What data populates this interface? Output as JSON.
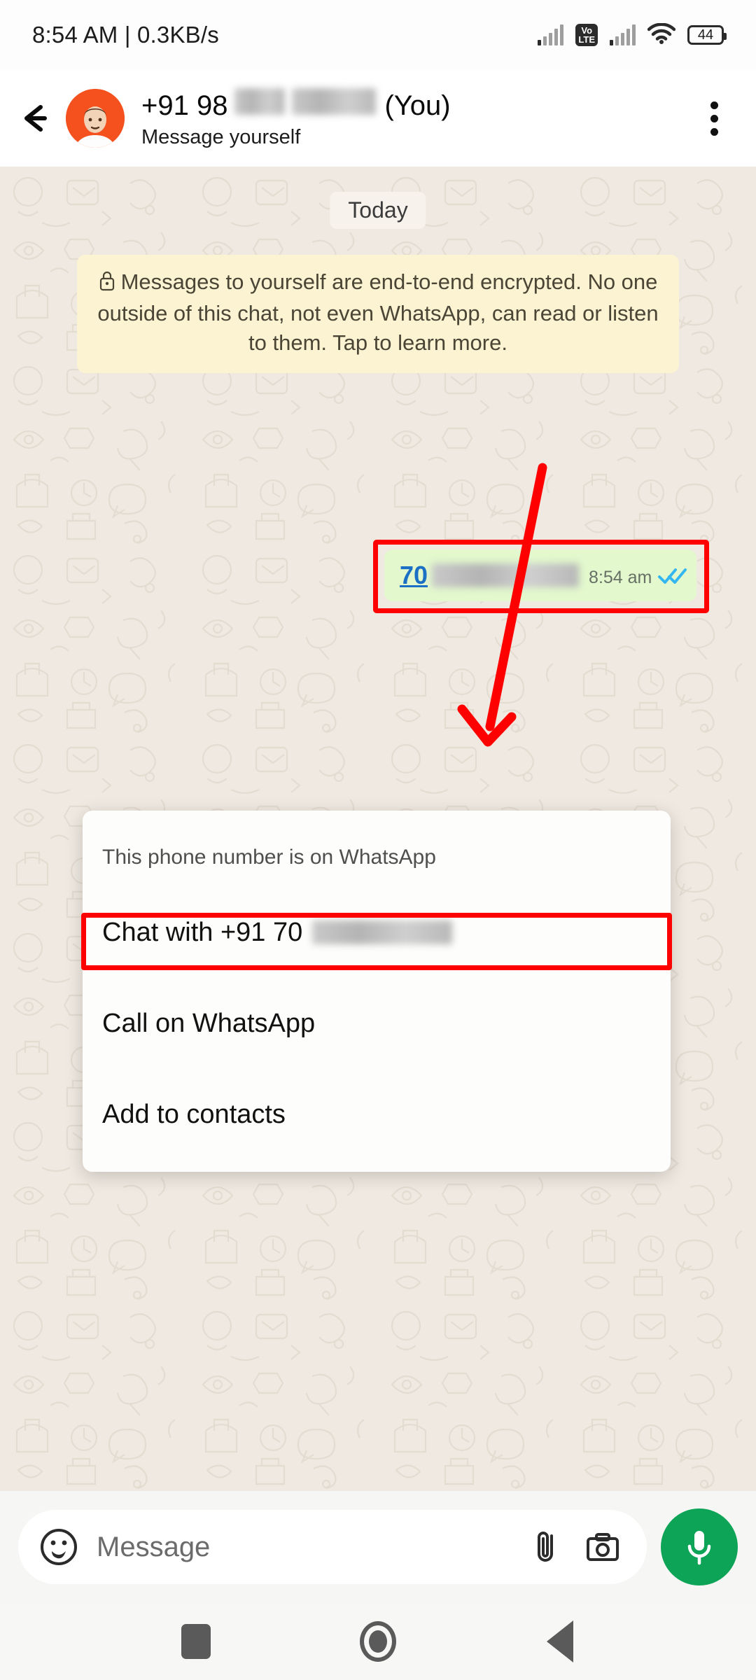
{
  "status_bar": {
    "time_and_speed": "8:54 AM | 0.3KB/s",
    "battery_level": "44",
    "volte_top": "Vo",
    "volte_bottom": "LTE",
    "icons": [
      "signal-bars-icon",
      "volte-icon",
      "signal-bars-icon",
      "wifi-icon",
      "battery-icon"
    ]
  },
  "header": {
    "back_icon": "back-arrow-icon",
    "avatar": "contact-avatar",
    "title_prefix": "+91 98",
    "title_suffix": "(You)",
    "subtitle": "Message yourself",
    "overflow_icon": "overflow-menu-icon"
  },
  "chat": {
    "day_divider": "Today",
    "encryption_notice": "Messages to yourself are end-to-end encrypted. No one outside of this chat, not even WhatsApp, can read or listen to them. Tap to learn more.",
    "lock_icon": "lock-icon",
    "message": {
      "link_prefix": "70",
      "time": "8:54 am",
      "status_icon": "double-check-read-icon"
    }
  },
  "popup": {
    "title": "This phone number is on WhatsApp",
    "items": [
      {
        "label": "Chat with +91 70",
        "highlighted": true
      },
      {
        "label": "Call on WhatsApp",
        "highlighted": false
      },
      {
        "label": "Add to contacts",
        "highlighted": false
      }
    ]
  },
  "input_bar": {
    "placeholder": "Message",
    "sticker_icon": "sticker-emoji-icon",
    "attach_icon": "paperclip-attach-icon",
    "camera_icon": "camera-icon",
    "mic_icon": "microphone-icon"
  },
  "nav_bar": {
    "recents": "recents-square-icon",
    "home": "home-circle-icon",
    "back": "back-triangle-icon"
  },
  "colors": {
    "accent_green": "#0DA457",
    "bubble_green": "#E3F8CD",
    "link_blue": "#1B6FC4",
    "read_tick_blue": "#34B7F1",
    "annotation_red": "#FF0000",
    "avatar_orange": "#F4511E",
    "encryption_banner": "#FCF3D3",
    "wallpaper": "#EFE9E1"
  }
}
